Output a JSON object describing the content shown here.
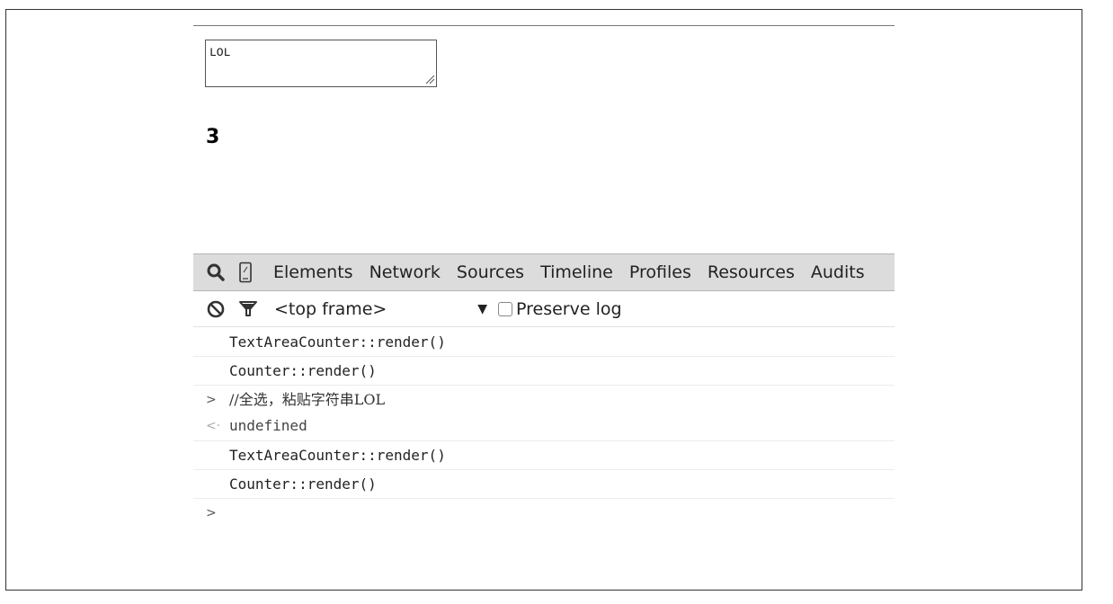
{
  "textarea": {
    "value": "LOL"
  },
  "counter": {
    "value": "3"
  },
  "devtools": {
    "tabs": [
      "Elements",
      "Network",
      "Sources",
      "Timeline",
      "Profiles",
      "Resources",
      "Audits"
    ],
    "icons": {
      "search": "search-icon",
      "device": "device-mode-icon",
      "clear": "clear-console-icon",
      "filter": "filter-icon",
      "frame_arrow": "dropdown-arrow-icon"
    },
    "console_bar": {
      "frame": "<top frame>",
      "frame_arrow": "▼",
      "preserve_log_label": "Preserve log",
      "preserve_log_checked": false
    },
    "console_lines": [
      {
        "kind": "log",
        "text": "TextAreaCounter::render()"
      },
      {
        "kind": "log",
        "text": "Counter::render()"
      },
      {
        "kind": "input",
        "glyph": ">",
        "text": "//全选，粘贴字符串LOL"
      },
      {
        "kind": "result",
        "glyph": "<·",
        "text": "undefined"
      },
      {
        "kind": "log",
        "text": "TextAreaCounter::render()"
      },
      {
        "kind": "log",
        "text": "Counter::render()"
      },
      {
        "kind": "prompt",
        "glyph": ">",
        "text": ""
      }
    ]
  }
}
